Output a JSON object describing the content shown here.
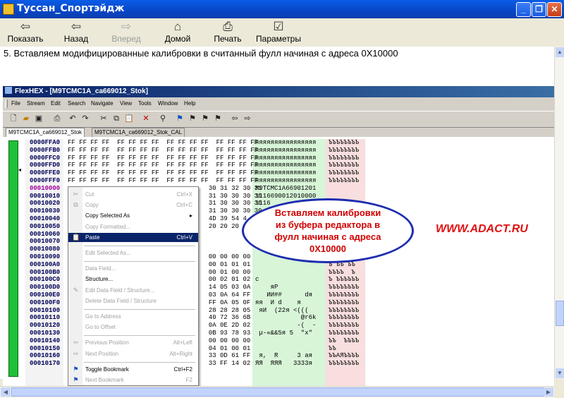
{
  "window": {
    "title": "Туссан_Спортэйдж"
  },
  "toolbar": {
    "show": "Показать",
    "back": "Назад",
    "forward": "Вперед",
    "home": "Домой",
    "print": "Печать",
    "options": "Параметры"
  },
  "step_text": "5. Вставляем модифицированные калибровки в считанный фулл начиная с адреса 0X10000",
  "flexhex": {
    "title": "FlexHEX - [M9TCMC1A_ca669012_Stok]",
    "menu": [
      "File",
      "Stream",
      "Edit",
      "Search",
      "Navigate",
      "View",
      "Tools",
      "Window",
      "Help"
    ],
    "tabs": [
      "M9TCMC1A_ca669012_Stok",
      "M9TCMC1A_ca669012_Stok_CAL"
    ],
    "rows": [
      {
        "addr": "0000FFA0",
        "hex": "FF FF FF FF  FF FF FF FF  FF FF FF FF  FF FF FF FF",
        "asc": "яяяяяяяяяяяяяяяя",
        "asc2": "ЪЪЪЪЪЪЪЪ"
      },
      {
        "addr": "0000FFB0",
        "hex": "FF FF FF FF  FF FF FF FF  FF FF FF FF  FF FF FF FF",
        "asc": "яяяяяяяяяяяяяяяя",
        "asc2": "ЪЪЪЪЪЪЪЪ"
      },
      {
        "addr": "0000FFC0",
        "hex": "FF FF FF FF  FF FF FF FF  FF FF FF FF  FF FF FF FF",
        "asc": "яяяяяяяяяяяяяяяя",
        "asc2": "ЪЪЪЪЪЪЪЪ"
      },
      {
        "addr": "0000FFD0",
        "hex": "FF FF FF FF  FF FF FF FF  FF FF FF FF  FF FF FF FF",
        "asc": "яяяяяяяяяяяяяяяя",
        "asc2": "ЪЪЪЪЪЪЪЪ"
      },
      {
        "addr": "0000FFE0",
        "hex": "FF FF FF FF  FF FF FF FF  FF FF FF FF  FF FF FF FF",
        "asc": "яяяяяяяяяяяяяяяя",
        "asc2": "ЪЪЪЪЪЪЪЪ"
      },
      {
        "addr": "0000FFF0",
        "hex": "FF FF FF FF  FF FF FF FF  FF FF FF FF  FF FF FF FF",
        "asc": "яяяяяяяяяяяяяяяя",
        "asc2": "ЪЪЪЪЪЪЪЪ"
      },
      {
        "addr": "00010000",
        "hex": "                                     30 31 32 30 31",
        "asc": "M9TCMC1A66901201",
        "asc2": "",
        "selected": true
      },
      {
        "addr": "00010010",
        "hex": "                                     31 30 30 30 30",
        "asc": "1116690012010000",
        "asc2": ""
      },
      {
        "addr": "00010020",
        "hex": "                                     31 30 30 30 30",
        "asc": "1116",
        "asc2": ""
      },
      {
        "addr": "00010030",
        "hex": "                                     31 30 30 30 30",
        "asc": "",
        "asc2": ""
      },
      {
        "addr": "00010040",
        "hex": "                                     4D 39 54 4",
        "asc": "",
        "asc2": ""
      },
      {
        "addr": "00010050",
        "hex": "                                     20 20 20 2",
        "asc": "",
        "asc2": ""
      },
      {
        "addr": "00010060",
        "hex": "",
        "asc": "",
        "asc2": ""
      },
      {
        "addr": "00010070",
        "hex": "",
        "asc": "",
        "asc2": ""
      },
      {
        "addr": "00010080",
        "hex": "",
        "asc": "",
        "asc2": ""
      },
      {
        "addr": "00010090",
        "hex": "                                     00 00 00 00",
        "asc": "",
        "asc2": ""
      },
      {
        "addr": "000100A0",
        "hex": "                                     00 01 01 01",
        "asc": "",
        "asc2": "Ъ ЪЪ ЪЪ"
      },
      {
        "addr": "000100B0",
        "hex": "                                     00 01 00 00",
        "asc": "",
        "asc2": "ЪЪЪЪ  Ъ"
      },
      {
        "addr": "000100C0",
        "hex": "                                     00 02 01 02",
        "asc": "с",
        "asc2": "Ъ ЪЪЪЪЪЪ"
      },
      {
        "addr": "000100D0",
        "hex": "                                     14 05 03 0A",
        "asc": "    яР",
        "asc2": "ЪЪЪЪЪЪЪЪ"
      },
      {
        "addr": "000100E0",
        "hex": "                                     03 0A 64 FF",
        "asc": "   ИИ##      dя",
        "asc2": "ЪЪЪЪЪЪЪЪ"
      },
      {
        "addr": "000100F0",
        "hex": "                                     FF 0A 05 0F",
        "asc": "яя  И d    я",
        "asc2": "ЪЪЪЪЪЪЪЪ"
      },
      {
        "addr": "00010100",
        "hex": "                                     28 28 28 05",
        "asc": " яИ  (22я <(((",
        "asc2": "ЪЪЪЪЪЪЪЪ"
      },
      {
        "addr": "00010110",
        "hex": "                                     40 72 36 6B",
        "asc": "            @r6k",
        "asc2": "ЪЪЪЪЪЪЪЪ"
      },
      {
        "addr": "00010120",
        "hex": "                                     0A 0E 2D 02",
        "asc": "           -(  -",
        "asc2": "ЪЪЪЪЪЪЪЪ"
      },
      {
        "addr": "00010130",
        "hex": "                                     0B 93 78 93",
        "asc": " µ-«&&5я 5  \"x\"",
        "asc2": "ЪЪЪЪЪЪЪЪ"
      },
      {
        "addr": "00010140",
        "hex": "                                     00 00 00 00",
        "asc": "",
        "asc2": "ЪЪ  ЪЪЪЪ"
      },
      {
        "addr": "00010150",
        "hex": "                                     04 01 00 01",
        "asc": "",
        "asc2": "ЪЪ"
      },
      {
        "addr": "00010160",
        "hex": "                                     33 0D 61 FF",
        "asc": " я,  R     3 ая",
        "asc2": "ЪЪАЯЪЪЪЪ"
      },
      {
        "addr": "00010170",
        "hex": "                                     33 FF 14 02",
        "asc": "ЯЯ  ЯЯЯ   3333я",
        "asc2": "ЪЪЪЪЪЪЪЪ"
      }
    ],
    "context_menu": [
      {
        "label": "Cut",
        "shortcut": "Ctrl+X",
        "disabled": true,
        "icon": "scissors-icon"
      },
      {
        "label": "Copy",
        "shortcut": "Ctrl+C",
        "disabled": true,
        "icon": "copy-icon"
      },
      {
        "label": "Copy Selected As",
        "shortcut": "",
        "disabled": false,
        "submenu": true
      },
      {
        "label": "Copy Formatted...",
        "shortcut": "",
        "disabled": true
      },
      {
        "label": "Paste",
        "shortcut": "Ctrl+V",
        "disabled": false,
        "highlighted": true,
        "icon": "paste-icon"
      },
      {
        "sep": true
      },
      {
        "label": "Edit Selected As...",
        "shortcut": "",
        "disabled": true
      },
      {
        "sep": true
      },
      {
        "label": "Data Field...",
        "shortcut": "",
        "disabled": true
      },
      {
        "label": "Structure...",
        "shortcut": "",
        "disabled": false
      },
      {
        "label": "Edit Data Field / Structure...",
        "shortcut": "",
        "disabled": true,
        "icon": "edit-icon"
      },
      {
        "label": "Delete Data Field / Structure",
        "shortcut": "",
        "disabled": true
      },
      {
        "sep": true
      },
      {
        "label": "Go to Address",
        "shortcut": "",
        "disabled": true
      },
      {
        "label": "Go to Offset",
        "shortcut": "",
        "disabled": true
      },
      {
        "sep": true
      },
      {
        "label": "Previous Position",
        "shortcut": "Alt+Left",
        "disabled": true,
        "icon": "arrow-left-icon"
      },
      {
        "label": "Next Position",
        "shortcut": "Alt+Right",
        "disabled": true,
        "icon": "arrow-right-icon"
      },
      {
        "sep": true
      },
      {
        "label": "Toggle Bookmark",
        "shortcut": "Ctrl+F2",
        "disabled": false,
        "icon": "bookmark-icon"
      },
      {
        "label": "Next Bookmark",
        "shortcut": "F2",
        "disabled": true,
        "icon": "bookmark-next-icon"
      }
    ]
  },
  "watermark": "WWW.ADACT.RU",
  "callout": [
    "Вставляем калибровки",
    "из буфера редактора в",
    "фулл начиная с адреса",
    "0X10000"
  ],
  "colors": {
    "titlebar": "#0A5CE6",
    "callout_text": "#D00000",
    "callout_border": "#1E2DB0",
    "watermark": "#E01010",
    "green_bar": "#1FC03A"
  }
}
